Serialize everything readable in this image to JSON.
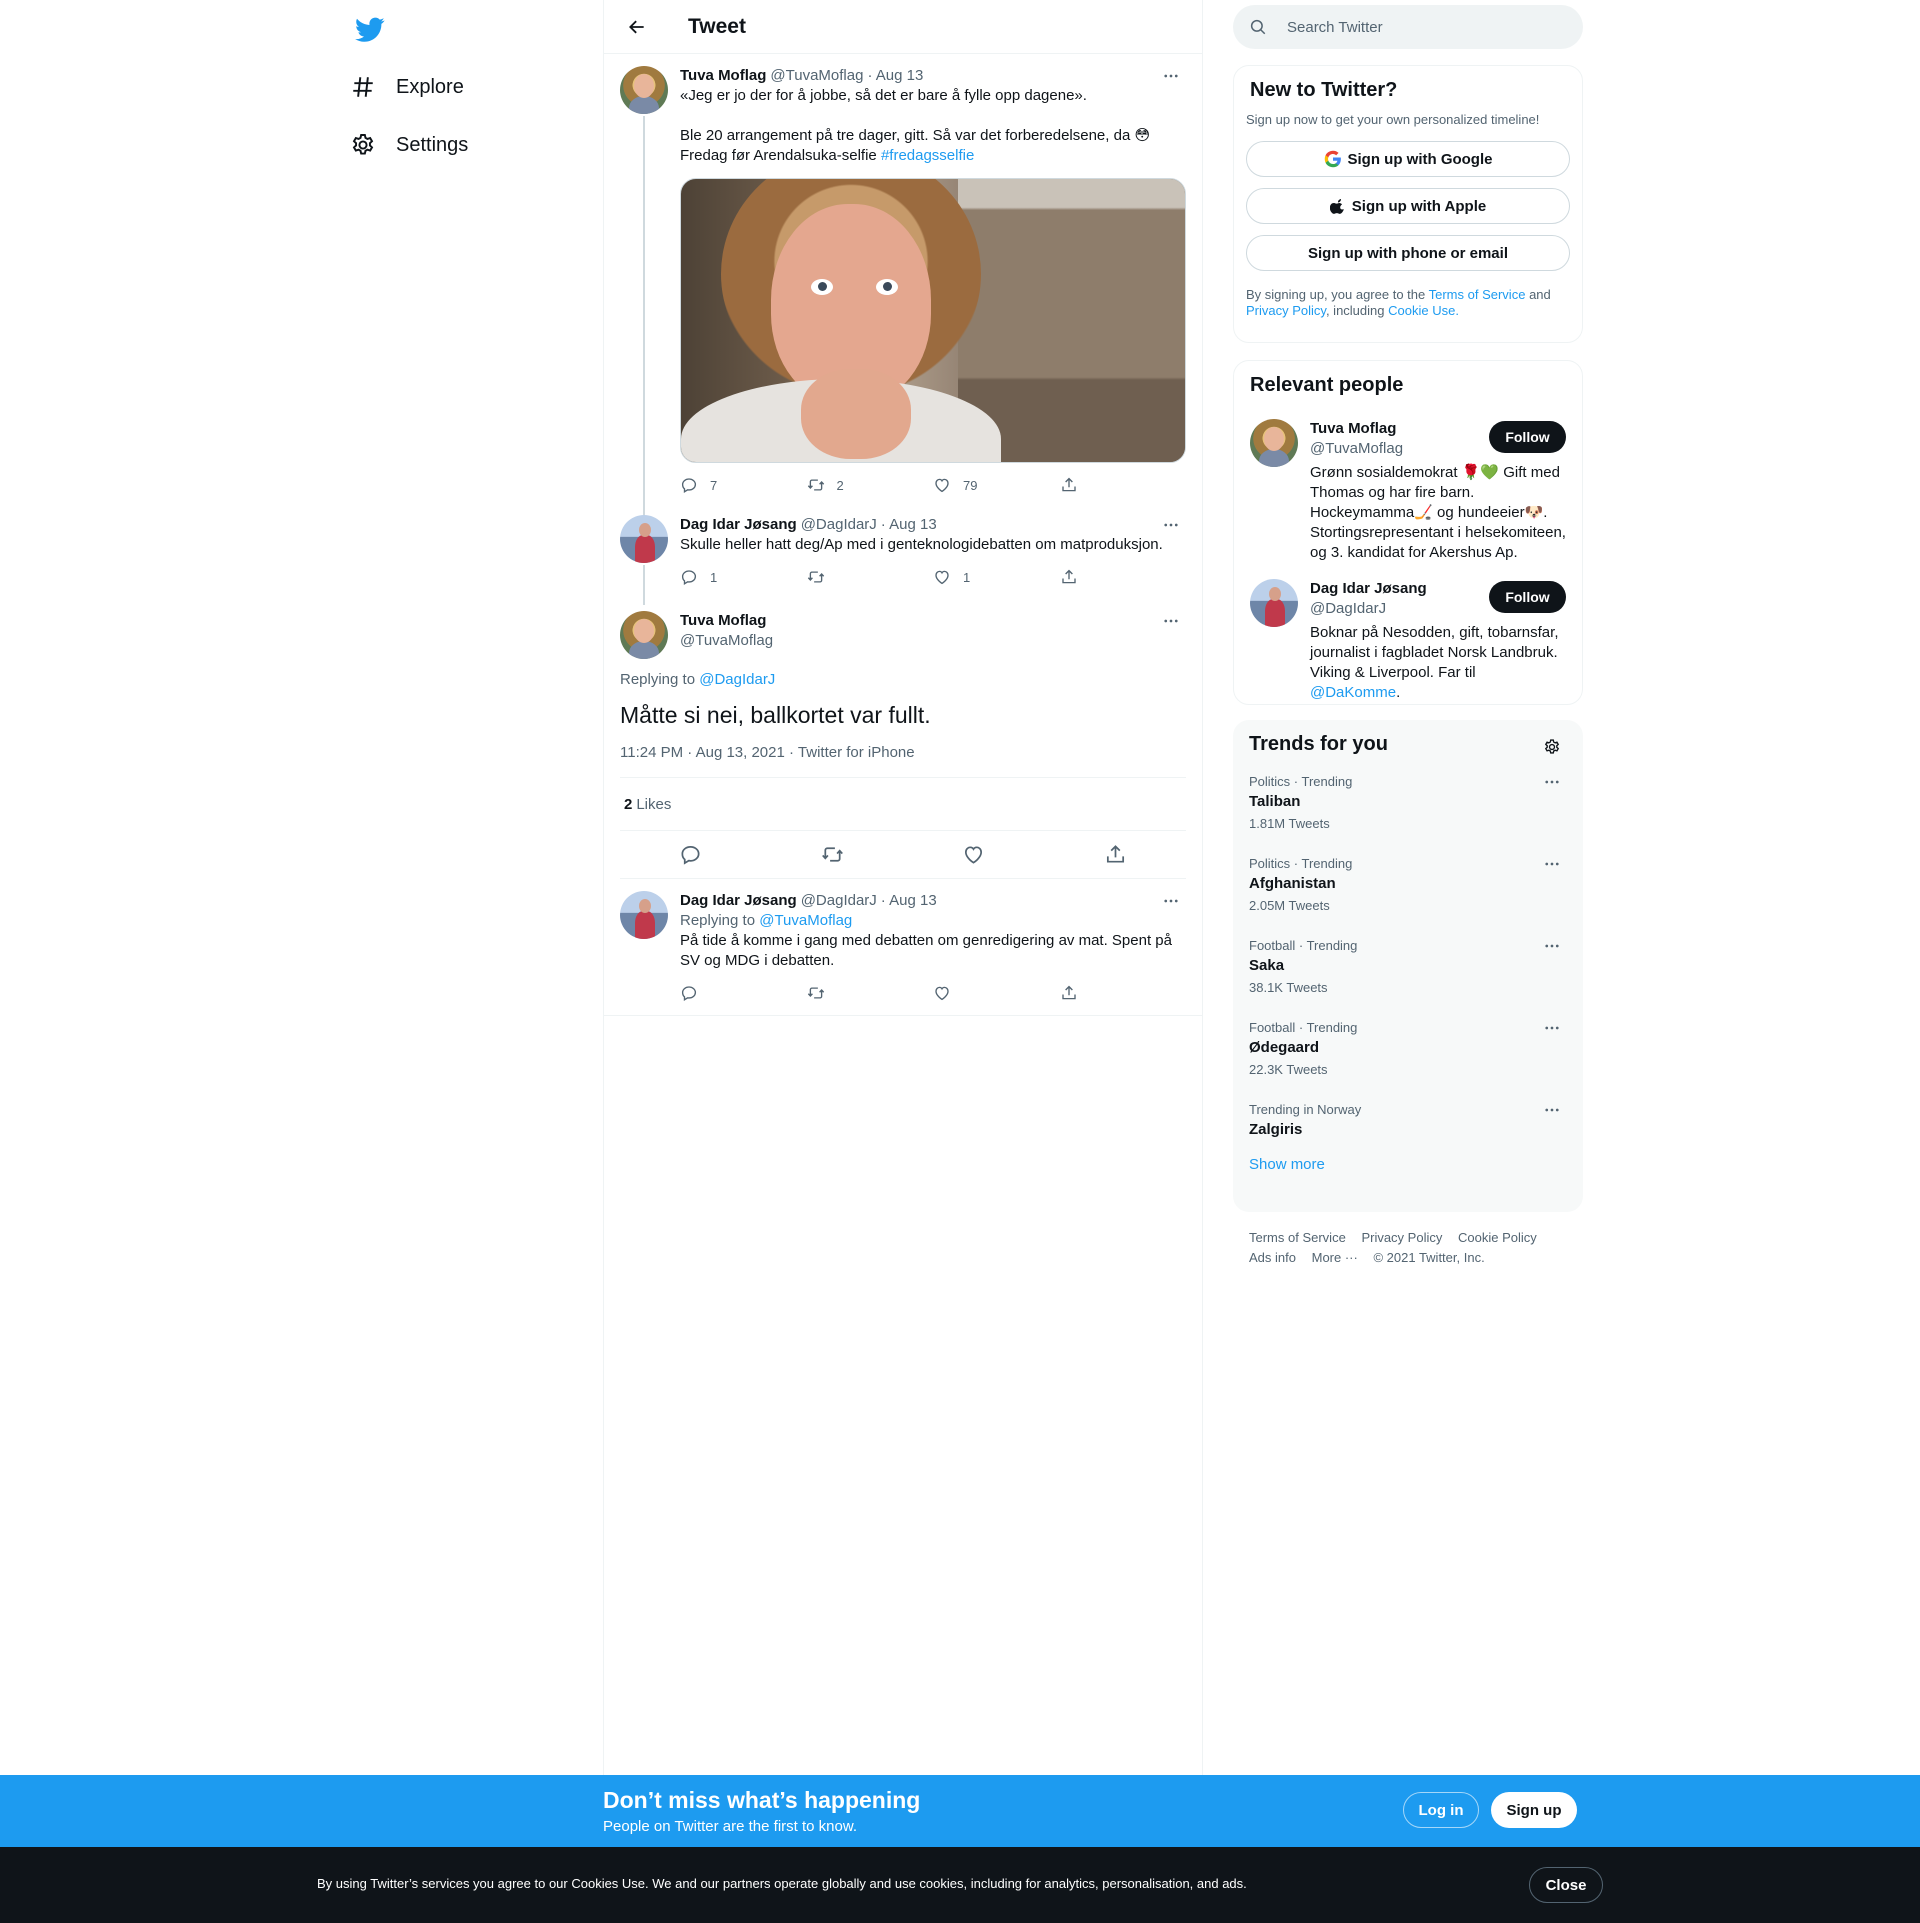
{
  "nav": {
    "logo_icon": "twitter-bird-icon",
    "items": [
      {
        "label": "Explore",
        "icon": "hashtag-icon"
      },
      {
        "label": "Settings",
        "icon": "gear-icon"
      }
    ]
  },
  "header": {
    "title": "Tweet",
    "back_icon": "arrow-left-icon"
  },
  "thread": {
    "tweet1": {
      "name": "Tuva Moflag",
      "handle": "@TuvaMoflag",
      "date": "· Aug 13",
      "text_line1": "«Jeg er jo der for å jobbe, så det er bare å fylle opp dagene».",
      "text_line2": "Ble 20 arrangement på tre dager, gitt. Så var det forberedelsene, da 😳",
      "text_line3": "Fredag før Arendalsuka-selfie",
      "hashtag": "#fredagsselfie",
      "replies": "7",
      "retweets": "2",
      "likes": "79"
    },
    "tweet2": {
      "name": "Dag Idar Jøsang",
      "handle": "@DagIdarJ",
      "date": "· Aug 13",
      "text": "Skulle heller hatt deg/Ap med i genteknologidebatten om matproduksjon.",
      "replies": "1",
      "retweets": "",
      "likes": "1"
    },
    "focal": {
      "name": "Tuva Moflag",
      "handle": "@TuvaMoflag",
      "replying_prefix": "Replying to",
      "replying_to": "@DagIdarJ",
      "text": "Måtte si nei, ballkortet var fullt.",
      "meta": "11:24 PM · Aug 13, 2021 · Twitter for iPhone",
      "likes_count": "2",
      "likes_label": "Likes"
    },
    "reply": {
      "name": "Dag Idar Jøsang",
      "handle": "@DagIdarJ",
      "date": "· Aug 13",
      "replying_prefix": "Replying to",
      "replying_to": "@TuvaMoflag",
      "text": "På tide å komme i gang med debatten om genredigering av mat. Spent på SV og MDG i debatten."
    }
  },
  "search": {
    "placeholder": "Search Twitter"
  },
  "new_to_twitter": {
    "title": "New to Twitter?",
    "subtitle": "Sign up now to get your own personalized timeline!",
    "google": "Sign up with Google",
    "apple": "Sign up with Apple",
    "phone": "Sign up with phone or email",
    "legal_1": "By signing up, you agree to the",
    "terms": "Terms of Service",
    "legal_2": "and",
    "privacy": "Privacy Policy",
    "legal_3": ", including",
    "cookie": "Cookie Use."
  },
  "relevant_people": {
    "title": "Relevant people",
    "follow_label": "Follow",
    "people": [
      {
        "name": "Tuva Moflag",
        "handle": "@TuvaMoflag",
        "bio": "Grønn sosialdemokrat 🌹💚 Gift med Thomas og har fire barn. Hockeymamma🏒 og hundeeier🐶. Stortingsrepresentant i helsekomiteen, og 3. kandidat for Akershus Ap."
      },
      {
        "name": "Dag Idar Jøsang",
        "handle": "@DagIdarJ",
        "bio": "Boknar på Nesodden, gift, tobarnsfar, journalist i fagbladet Norsk Landbruk. Viking & Liverpool. Far til",
        "bio_link": "@DaKomme",
        "bio_end": "."
      }
    ]
  },
  "trends": {
    "title": "Trends for you",
    "items": [
      {
        "category": "Politics · Trending",
        "name": "Taliban",
        "count": "1.81M Tweets"
      },
      {
        "category": "Politics · Trending",
        "name": "Afghanistan",
        "count": "2.05M Tweets"
      },
      {
        "category": "Football · Trending",
        "name": "Saka",
        "count": "38.1K Tweets"
      },
      {
        "category": "Football · Trending",
        "name": "Ødegaard",
        "count": "22.3K Tweets"
      },
      {
        "category": "Trending in Norway",
        "name": "Zalgiris",
        "count": ""
      }
    ],
    "show_more": "Show more"
  },
  "footer": {
    "terms": "Terms of Service",
    "privacy": "Privacy Policy",
    "cookie": "Cookie Policy",
    "ads": "Ads info",
    "more": "More ···",
    "copyright": "© 2021 Twitter, Inc."
  },
  "signup_bar": {
    "title": "Don’t miss what’s happening",
    "subtitle": "People on Twitter are the first to know.",
    "login": "Log in",
    "signup": "Sign up"
  },
  "cookie_bar": {
    "text": "By using Twitter’s services you agree to our Cookies Use. We and our partners operate globally and use cookies, including for analytics, personalisation, and ads.",
    "close": "Close"
  },
  "colors": {
    "accent": "#1d9bf0",
    "text": "#0f1419",
    "muted": "#536471",
    "border": "#eff3f4"
  }
}
